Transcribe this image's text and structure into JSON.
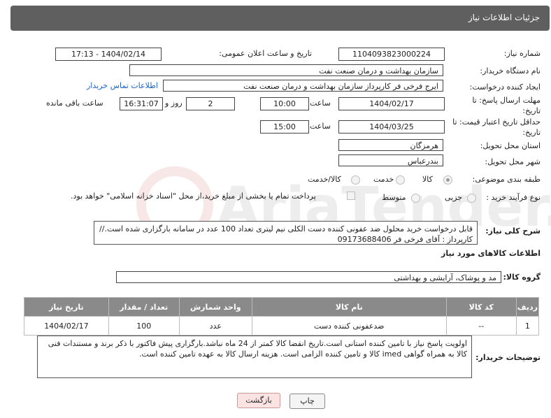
{
  "header": {
    "title": "جزئیات اطلاعات نیاز"
  },
  "fields": {
    "need_number_label": "شماره نیاز:",
    "need_number": "1104093823000224",
    "announce_label": "تاریخ و ساعت اعلان عمومی:",
    "announce_value": "1404/02/14 - 17:13",
    "buyer_org_label": "نام دستگاه خریدار:",
    "buyer_org": "سازمان بهداشت و درمان صنعت نفت",
    "creator_label": "ایجاد کننده درخواست:",
    "creator": "ایرج فرخی فر کارپرداز  سازمان بهداشت و درمان صنعت نفت",
    "contact_link": "اطلاعات تماس خریدار",
    "deadline_label": "مهلت ارسال پاسخ: تا تاریخ:",
    "deadline_date": "1404/02/17",
    "time_label": "ساعت",
    "deadline_time": "10:00",
    "days_value": "2",
    "days_label": "روز و",
    "remaining_time": "16:31:07",
    "remaining_label": "ساعت باقی مانده",
    "price_validity_label": "حداقل تاریخ اعتبار قیمت: تا تاریخ:",
    "price_date": "1404/03/25",
    "price_time": "15:00",
    "province_label": "استان محل تحویل:",
    "province": "هرمزگان",
    "city_label": "شهر محل تحویل:",
    "city": "بندرعباس",
    "category_label": "طبقه بندی موضوعی:",
    "cat_goods": "کالا",
    "cat_service": "خدمت",
    "cat_goods_service": "کالا/خدمت",
    "process_label": "نوع فرآیند خرید :",
    "proc_partial": "جزیی",
    "proc_medium": "متوسط",
    "payment_note": "پرداخت تمام یا بخشی از مبلغ خرید،از محل \"اسناد خزانه اسلامی\" خواهد بود.",
    "description_label": "شرح کلی نیاز:",
    "description": "قابل درخواست خرید محلول ضد عفونی کننده دست الکلی نیم لیتری تعداد 100 عدد در سامانه بارگزاری شده است.//کارپرداز : آقای فرخی فر 09173688406",
    "goods_info_title": "اطلاعات کالاهای مورد نیاز",
    "goods_group_label": "گروه کالا:",
    "goods_group": "مد و پوشاک، آرایشی و بهداشتی",
    "buyer_notes_label": "توضیحات خریدار:",
    "buyer_notes": "اولویت پاسخ نیاز با تامین کننده استانی است.تاریخ انقضا کالا کمتر از 24 ماه نباشد.بارگزاری پیش فاکتور با ذکر برند و مستندات فنی کالا به همراه گواهی imed کالا و تامین کننده الزامی است. هزینه ارسال کالا به عهده تامین کننده است."
  },
  "table": {
    "headers": [
      "ردیف",
      "کد کالا",
      "نام کالا",
      "واحد شمارش",
      "تعداد / مقدار",
      "تاریخ نیاز"
    ],
    "rows": [
      [
        "1",
        "--",
        "ضدعفونی کننده دست",
        "عدد",
        "100",
        "1404/02/17"
      ]
    ]
  },
  "buttons": {
    "print": "چاپ",
    "back": "بازگشت"
  },
  "watermark": "AriaTender.neT",
  "colors": {
    "header_bg": "#5f5f5f",
    "table_header_bg": "#8a8a8a",
    "link": "#1a64c8",
    "back_btn_bg": "#fbe3e3"
  }
}
